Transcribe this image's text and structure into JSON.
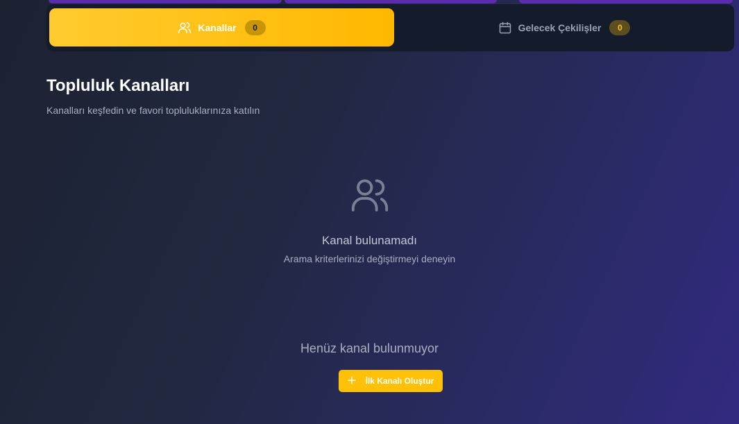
{
  "tabs": [
    {
      "label": "Kanallar",
      "count": "0",
      "icon": "users-icon",
      "active": true
    },
    {
      "label": "Gelecek Çekilişler",
      "count": "0",
      "icon": "calendar-icon",
      "active": false
    }
  ],
  "section": {
    "title": "Topluluk Kanalları",
    "subtitle": "Kanalları keşfedin ve favori topluluklarınıza katılın"
  },
  "empty_state": {
    "icon": "users-icon",
    "title": "Kanal bulunamadı",
    "hint": "Arama kriterlerinizi değiştirmeyi deneyin"
  },
  "no_channels": {
    "text": "Henüz kanal bulunmuyor",
    "button_label": "İlk Kanalı Oluştur",
    "button_icon": "plus-icon"
  },
  "colors": {
    "accent": "#ffc107",
    "tab_bg": "#141b2b"
  }
}
